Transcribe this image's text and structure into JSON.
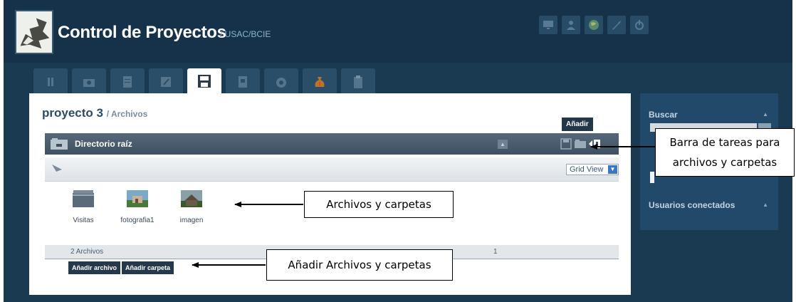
{
  "app": {
    "title": "Control de Proyectos",
    "subtitle": "/ USAC/BCIE"
  },
  "header_icons": [
    "monitor-icon",
    "user-icon",
    "globe-icon",
    "wrench-icon",
    "power-icon"
  ],
  "tabs": [
    {
      "icon": "info-icon",
      "active": false
    },
    {
      "icon": "camera-icon",
      "active": false
    },
    {
      "icon": "list-icon",
      "active": false
    },
    {
      "icon": "edit-icon",
      "active": false
    },
    {
      "icon": "save-icon",
      "active": true
    },
    {
      "icon": "document-icon",
      "active": false
    },
    {
      "icon": "satellite-icon",
      "active": false
    },
    {
      "icon": "money-bag-icon",
      "active": false
    },
    {
      "icon": "clipboard-icon",
      "active": false
    }
  ],
  "project": {
    "name": "proyecto 3",
    "section": "/ Archivos"
  },
  "tooltip": "Añadir",
  "directory": {
    "label": "Directorio raíz"
  },
  "view_select": {
    "value": "Grid View"
  },
  "files": [
    {
      "name": "Visitas",
      "icon": "folder-icon"
    },
    {
      "name": "fotografia1",
      "icon": "image-icon"
    },
    {
      "name": "imagen",
      "icon": "image-icon"
    }
  ],
  "status": {
    "count": "2 Archivos",
    "page": "1"
  },
  "buttons": {
    "add_file": "Añadir archivo",
    "add_folder": "Añadir carpeta"
  },
  "sidebar": {
    "search_title": "Buscar",
    "users_title": "Usuarios conectados"
  },
  "annotations": {
    "toolbar": "Barra de tareas para archivos y carpetas",
    "files": "Archivos y carpetas",
    "add": "Añadir Archivos y carpetas"
  },
  "colors": {
    "header": "#16324a",
    "background": "#1a3a52",
    "panel": "#ffffff",
    "button": "#25394b"
  }
}
